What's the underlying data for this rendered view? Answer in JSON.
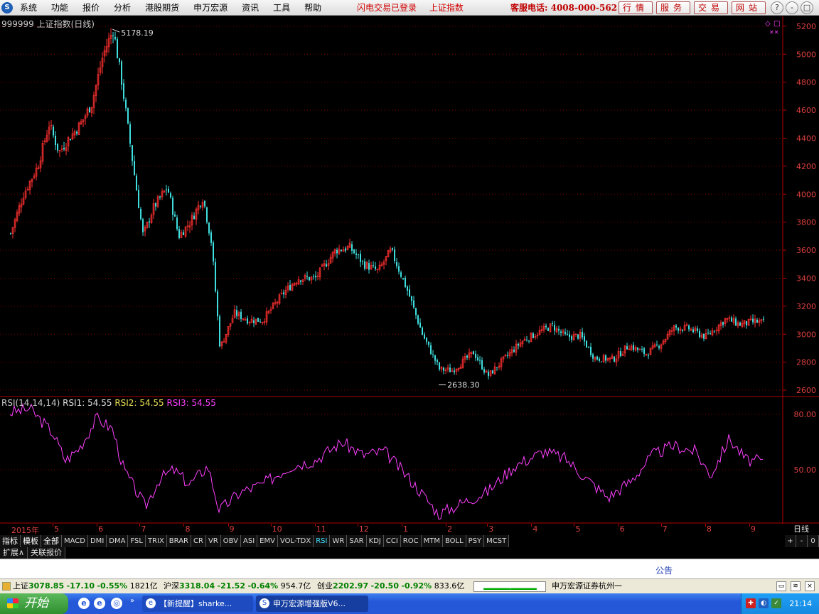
{
  "menu": {
    "items": [
      "系统",
      "功能",
      "报价",
      "分析",
      "港股期货",
      "申万宏源",
      "资讯",
      "工具",
      "帮助"
    ],
    "status": [
      "闪电交易已登录",
      "上证指数"
    ],
    "hotline": "客服电话: 4008-000-562",
    "buttons": [
      "行情",
      "服务",
      "交易",
      "网站"
    ],
    "window_buttons": [
      "?",
      "-",
      "□",
      "×"
    ]
  },
  "chart_header": {
    "title": "999999 上证指数(日线)",
    "high_label": "5178.19",
    "low_label": "2638.30"
  },
  "rsi": {
    "name": "RSI(14,14,14)",
    "rsi1_label": "RSI1:",
    "rsi1_value": "54.55",
    "rsi2_label": "RSI2:",
    "rsi2_value": "54.55",
    "rsi3_label": "RSI3:",
    "rsi3_value": "54.55",
    "ticks": [
      "80.00",
      "50.00"
    ]
  },
  "axis": {
    "price_ticks": [
      "5200",
      "5000",
      "4800",
      "4600",
      "4400",
      "4200",
      "4000",
      "3800",
      "3600",
      "3400",
      "3200",
      "3000",
      "2800",
      "2600"
    ],
    "months": [
      "2015年",
      "5",
      "6",
      "7",
      "8",
      "9",
      "10",
      "11",
      "12",
      "1",
      "2",
      "3",
      "4",
      "5",
      "6",
      "7",
      "8",
      "9"
    ],
    "period": "日线"
  },
  "tabs": {
    "items": [
      "指标",
      "模板",
      "全部",
      "MACD",
      "DMI",
      "DMA",
      "FSL",
      "TRIX",
      "BRAR",
      "CR",
      "VR",
      "OBV",
      "ASI",
      "EMV",
      "VOL-TDX",
      "RSI",
      "WR",
      "SAR",
      "KDJ",
      "CCI",
      "ROC",
      "MTM",
      "BOLL",
      "PSY",
      "MCST"
    ],
    "active": "RSI",
    "right": [
      "+",
      "-",
      "0"
    ]
  },
  "subtabs": [
    "扩展∧",
    "关联报价"
  ],
  "notice": "公告",
  "ticker": {
    "sh": {
      "name": "上证",
      "price": "3078.85",
      "change": "-17.10",
      "pct": "-0.55%",
      "vol": "1821亿"
    },
    "hs": {
      "name": "沪深",
      "price": "3318.04",
      "change": "-21.52",
      "pct": "-0.64%",
      "vol": "954.7亿"
    },
    "cy": {
      "name": "创业",
      "price": "2202.97",
      "change": "-20.50",
      "pct": "-0.92%",
      "vol": "833.6亿"
    },
    "broker": "申万宏源证券杭州一"
  },
  "taskbar": {
    "start": "开始",
    "tasks": [
      "【新提醒】sharke...",
      "申万宏源增强版V6..."
    ],
    "clock": "21:14"
  },
  "colors": {
    "up": "#ff3030",
    "down": "#40e0e0",
    "rsi": "#ff40ff",
    "grid": "#8b0000",
    "axis_text": "#e04040"
  },
  "chart_data": {
    "type": "candlestick",
    "title": "999999 上证指数(日线)",
    "x_range": [
      "2015-04",
      "2016-09"
    ],
    "ylim": [
      2580,
      5250
    ],
    "close_series_approx": [
      {
        "x": "2015-04-01",
        "y": 3720
      },
      {
        "x": "2015-04-10",
        "y": 4000
      },
      {
        "x": "2015-04-20",
        "y": 4200
      },
      {
        "x": "2015-04-28",
        "y": 4500
      },
      {
        "x": "2015-05-05",
        "y": 4300
      },
      {
        "x": "2015-05-12",
        "y": 4400
      },
      {
        "x": "2015-05-20",
        "y": 4500
      },
      {
        "x": "2015-05-28",
        "y": 4650
      },
      {
        "x": "2015-06-05",
        "y": 5000
      },
      {
        "x": "2015-06-12",
        "y": 5178
      },
      {
        "x": "2015-06-18",
        "y": 4800
      },
      {
        "x": "2015-06-26",
        "y": 4200
      },
      {
        "x": "2015-07-03",
        "y": 3700
      },
      {
        "x": "2015-07-10",
        "y": 3900
      },
      {
        "x": "2015-07-20",
        "y": 4050
      },
      {
        "x": "2015-07-28",
        "y": 3700
      },
      {
        "x": "2015-08-05",
        "y": 3800
      },
      {
        "x": "2015-08-14",
        "y": 3980
      },
      {
        "x": "2015-08-20",
        "y": 3650
      },
      {
        "x": "2015-08-26",
        "y": 2900
      },
      {
        "x": "2015-09-05",
        "y": 3150
      },
      {
        "x": "2015-09-15",
        "y": 3100
      },
      {
        "x": "2015-09-25",
        "y": 3100
      },
      {
        "x": "2015-10-10",
        "y": 3300
      },
      {
        "x": "2015-10-20",
        "y": 3400
      },
      {
        "x": "2015-11-01",
        "y": 3400
      },
      {
        "x": "2015-11-15",
        "y": 3600
      },
      {
        "x": "2015-11-25",
        "y": 3620
      },
      {
        "x": "2015-12-05",
        "y": 3500
      },
      {
        "x": "2015-12-15",
        "y": 3450
      },
      {
        "x": "2015-12-24",
        "y": 3600
      },
      {
        "x": "2016-01-05",
        "y": 3300
      },
      {
        "x": "2016-01-15",
        "y": 3000
      },
      {
        "x": "2016-01-27",
        "y": 2750
      },
      {
        "x": "2016-02-05",
        "y": 2740
      },
      {
        "x": "2016-02-20",
        "y": 2870
      },
      {
        "x": "2016-03-01",
        "y": 2700
      },
      {
        "x": "2016-03-15",
        "y": 2850
      },
      {
        "x": "2016-03-25",
        "y": 2950
      },
      {
        "x": "2016-04-05",
        "y": 3010
      },
      {
        "x": "2016-04-15",
        "y": 3060
      },
      {
        "x": "2016-04-25",
        "y": 2980
      },
      {
        "x": "2016-05-05",
        "y": 2990
      },
      {
        "x": "2016-05-15",
        "y": 2830
      },
      {
        "x": "2016-05-28",
        "y": 2820
      },
      {
        "x": "2016-06-08",
        "y": 2920
      },
      {
        "x": "2016-06-20",
        "y": 2860
      },
      {
        "x": "2016-06-30",
        "y": 2930
      },
      {
        "x": "2016-07-10",
        "y": 3050
      },
      {
        "x": "2016-07-20",
        "y": 3040
      },
      {
        "x": "2016-08-01",
        "y": 2980
      },
      {
        "x": "2016-08-15",
        "y": 3110
      },
      {
        "x": "2016-08-25",
        "y": 3070
      },
      {
        "x": "2016-09-05",
        "y": 3090
      },
      {
        "x": "2016-09-12",
        "y": 3079
      }
    ],
    "rsi_series_approx": [
      {
        "x": "2015-04-01",
        "y": 81
      },
      {
        "x": "2015-04-15",
        "y": 83
      },
      {
        "x": "2015-05-01",
        "y": 70
      },
      {
        "x": "2015-05-10",
        "y": 55
      },
      {
        "x": "2015-05-20",
        "y": 62
      },
      {
        "x": "2015-06-01",
        "y": 78
      },
      {
        "x": "2015-06-12",
        "y": 72
      },
      {
        "x": "2015-06-20",
        "y": 50
      },
      {
        "x": "2015-07-05",
        "y": 30
      },
      {
        "x": "2015-07-15",
        "y": 45
      },
      {
        "x": "2015-07-25",
        "y": 50
      },
      {
        "x": "2015-08-05",
        "y": 42
      },
      {
        "x": "2015-08-18",
        "y": 52
      },
      {
        "x": "2015-08-26",
        "y": 28
      },
      {
        "x": "2015-09-10",
        "y": 38
      },
      {
        "x": "2015-09-25",
        "y": 42
      },
      {
        "x": "2015-10-15",
        "y": 52
      },
      {
        "x": "2015-11-01",
        "y": 55
      },
      {
        "x": "2015-11-20",
        "y": 65
      },
      {
        "x": "2015-12-05",
        "y": 58
      },
      {
        "x": "2015-12-20",
        "y": 60
      },
      {
        "x": "2016-01-10",
        "y": 42
      },
      {
        "x": "2016-01-27",
        "y": 26
      },
      {
        "x": "2016-02-15",
        "y": 33
      },
      {
        "x": "2016-03-01",
        "y": 38
      },
      {
        "x": "2016-03-20",
        "y": 52
      },
      {
        "x": "2016-04-10",
        "y": 60
      },
      {
        "x": "2016-04-25",
        "y": 56
      },
      {
        "x": "2016-05-10",
        "y": 45
      },
      {
        "x": "2016-05-25",
        "y": 35
      },
      {
        "x": "2016-06-10",
        "y": 44
      },
      {
        "x": "2016-06-25",
        "y": 58
      },
      {
        "x": "2016-07-10",
        "y": 63
      },
      {
        "x": "2016-07-25",
        "y": 60
      },
      {
        "x": "2016-08-05",
        "y": 47
      },
      {
        "x": "2016-08-18",
        "y": 67
      },
      {
        "x": "2016-08-30",
        "y": 55
      },
      {
        "x": "2016-09-12",
        "y": 54.55
      }
    ]
  }
}
